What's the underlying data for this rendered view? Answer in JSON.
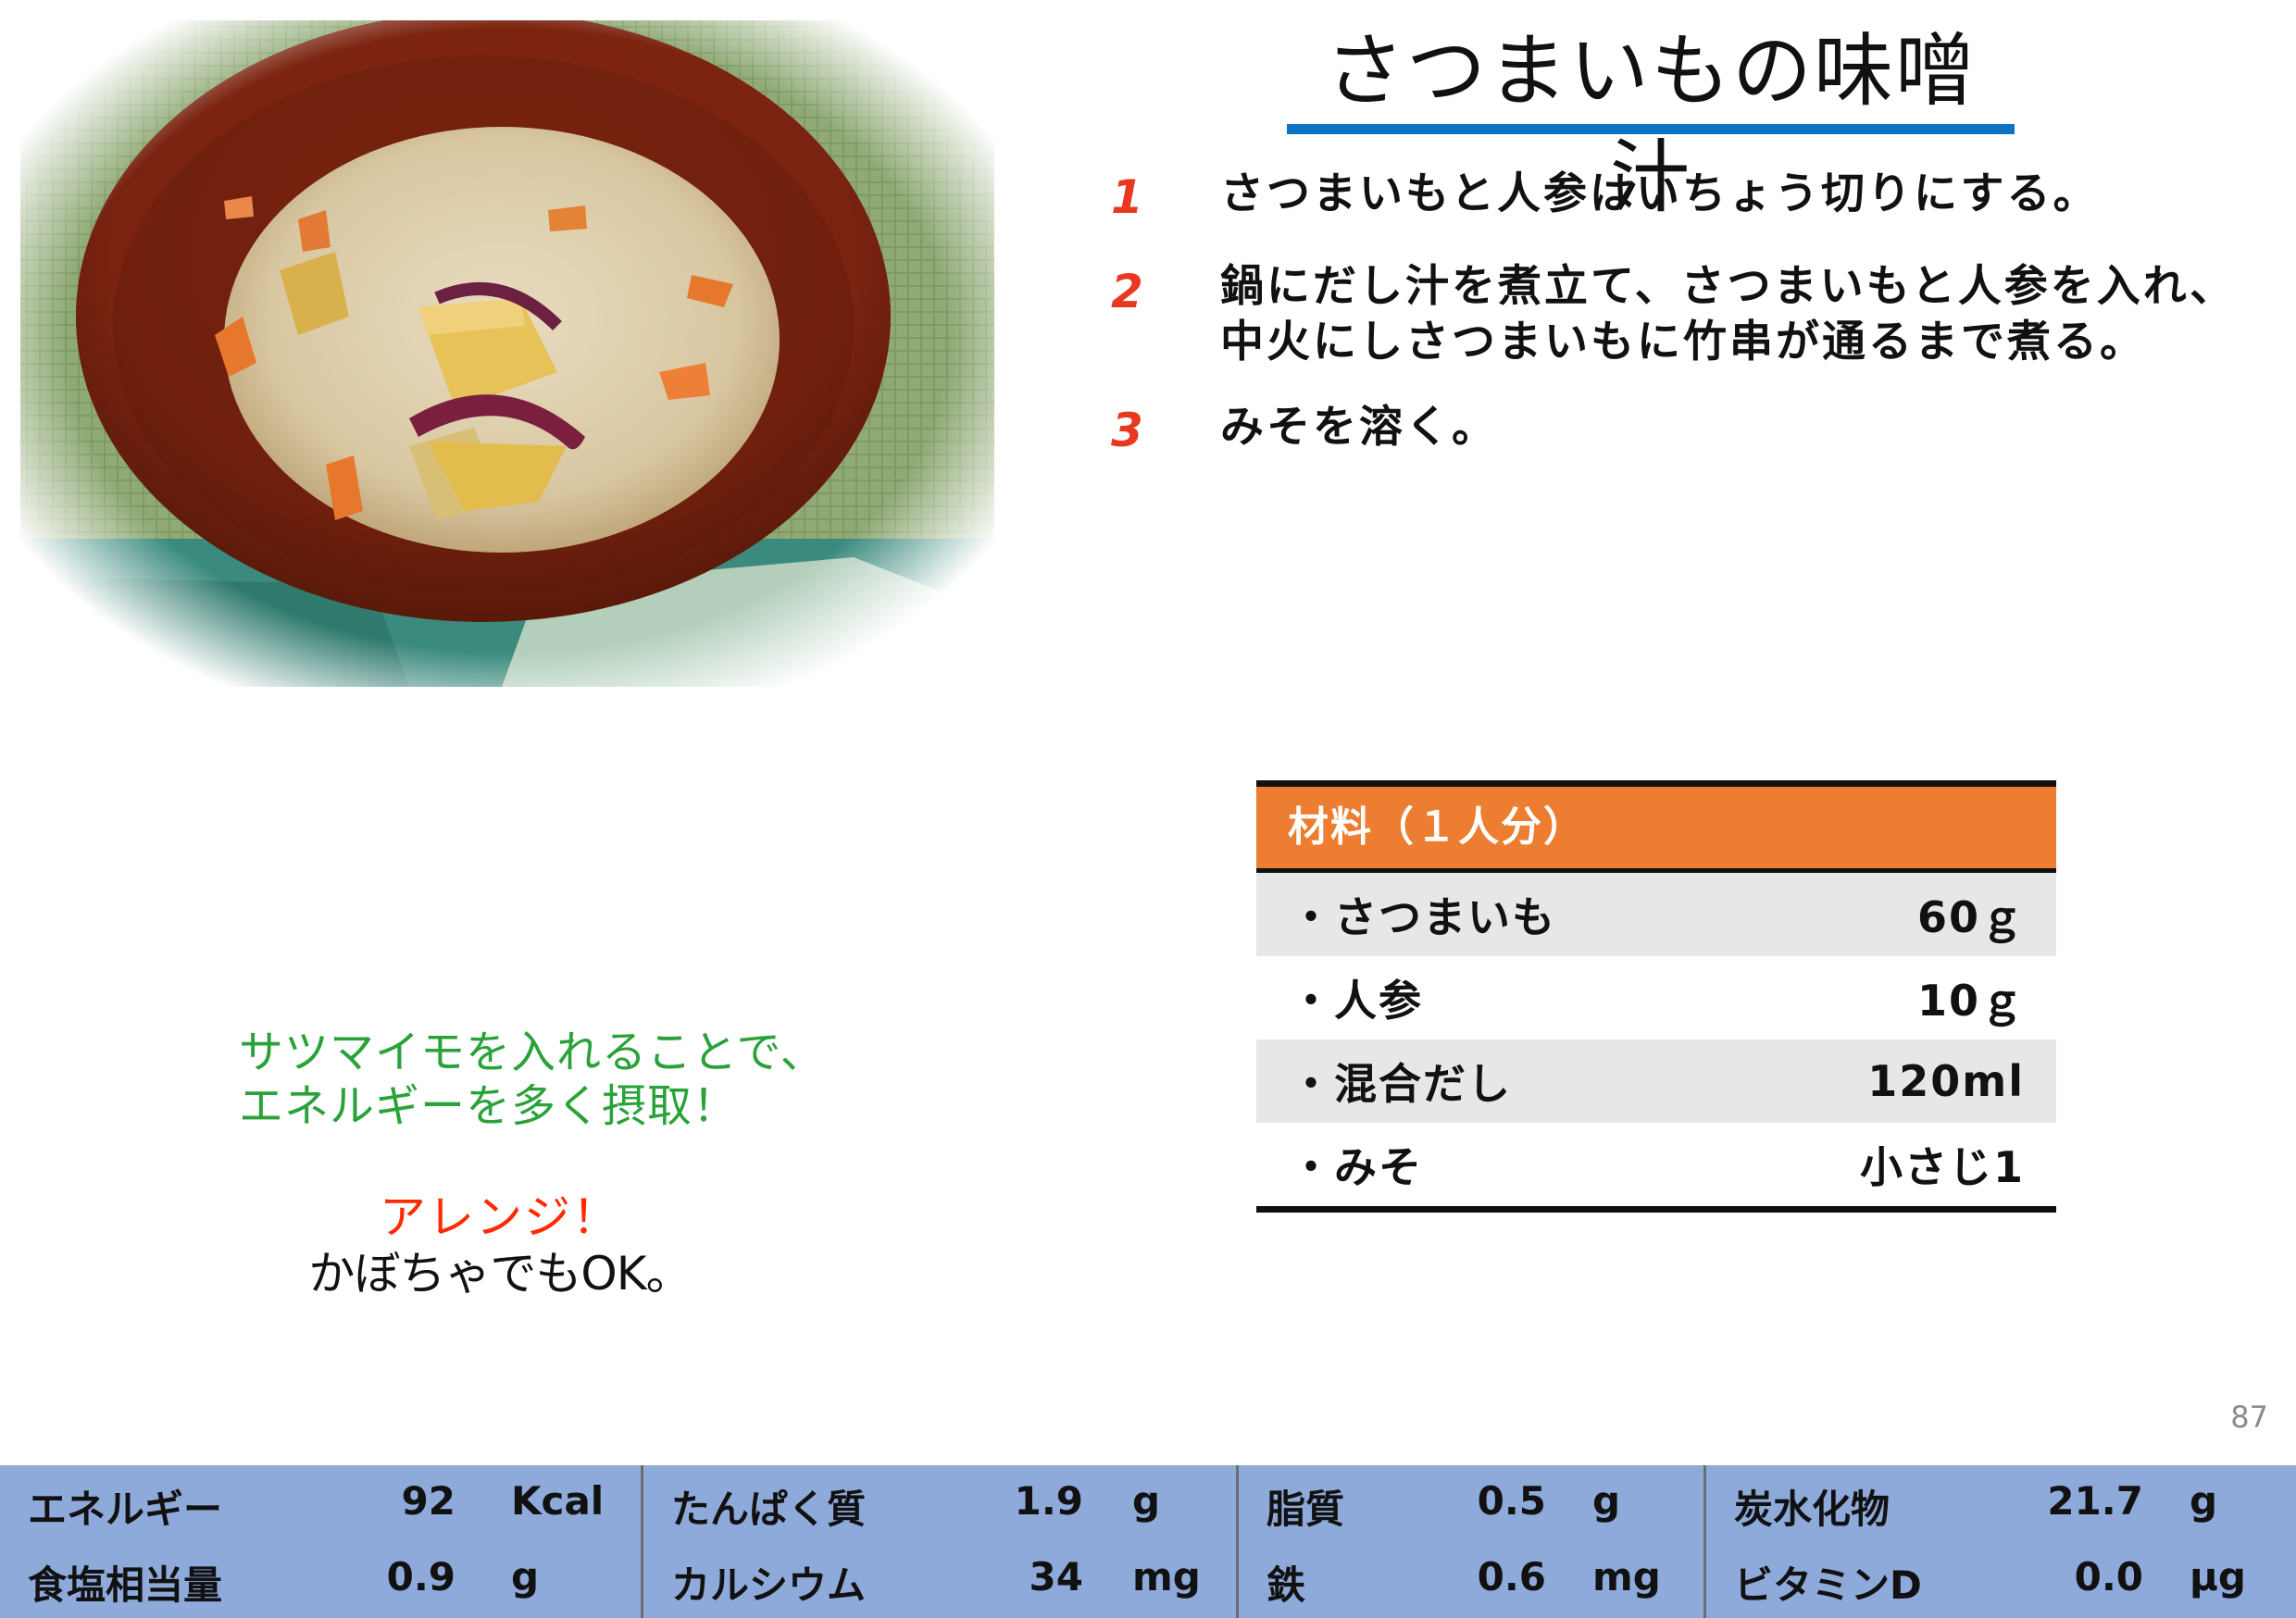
{
  "title": "さつまいもの味噌汁",
  "steps": [
    {
      "num": "1",
      "text": "さつまいもと人参はいちょう切りにする。"
    },
    {
      "num": "2",
      "text": "鍋にだし汁を煮立て、さつまいもと人参を入れ、中火にしさつまいもに竹串が通るまで煮る。"
    },
    {
      "num": "3",
      "text": "みそを溶く。"
    }
  ],
  "ingredients": {
    "header": "材料（１人分）",
    "items": [
      {
        "name": "・さつまいも",
        "amount": "60ｇ"
      },
      {
        "name": "・人参",
        "amount": "10ｇ"
      },
      {
        "name": "・混合だし",
        "amount": "120ml"
      },
      {
        "name": "・みそ",
        "amount": "小さじ1"
      }
    ]
  },
  "comment": {
    "line1": "サツマイモを入れることで、",
    "line2": "エネルギーを多く摂取！",
    "arrange": "アレンジ！",
    "arrange_text": "かぼちゃでもOK。"
  },
  "page_number": "87",
  "nutrition": [
    {
      "label": "エネルギー",
      "value": "92",
      "unit": "Kcal"
    },
    {
      "label": "たんぱく質",
      "value": "1.9",
      "unit": "g"
    },
    {
      "label": "脂質",
      "value": "0.5",
      "unit": "g"
    },
    {
      "label": "炭水化物",
      "value": "21.7",
      "unit": "g"
    },
    {
      "label": "食塩相当量",
      "value": "0.9",
      "unit": "g"
    },
    {
      "label": "カルシウム",
      "value": "34",
      "unit": "mg"
    },
    {
      "label": "鉄",
      "value": "0.6",
      "unit": "mg"
    },
    {
      "label": "ビタミンD",
      "value": "0.0",
      "unit": "μg"
    }
  ],
  "colors": {
    "accent_blue": "#0f72c2",
    "step_number_red": "#e8381f",
    "table_header_orange": "#ed7d31",
    "comment_green": "#2aa23a",
    "arrange_red": "#ff2a00",
    "nutrition_bar": "#8eaadb"
  }
}
